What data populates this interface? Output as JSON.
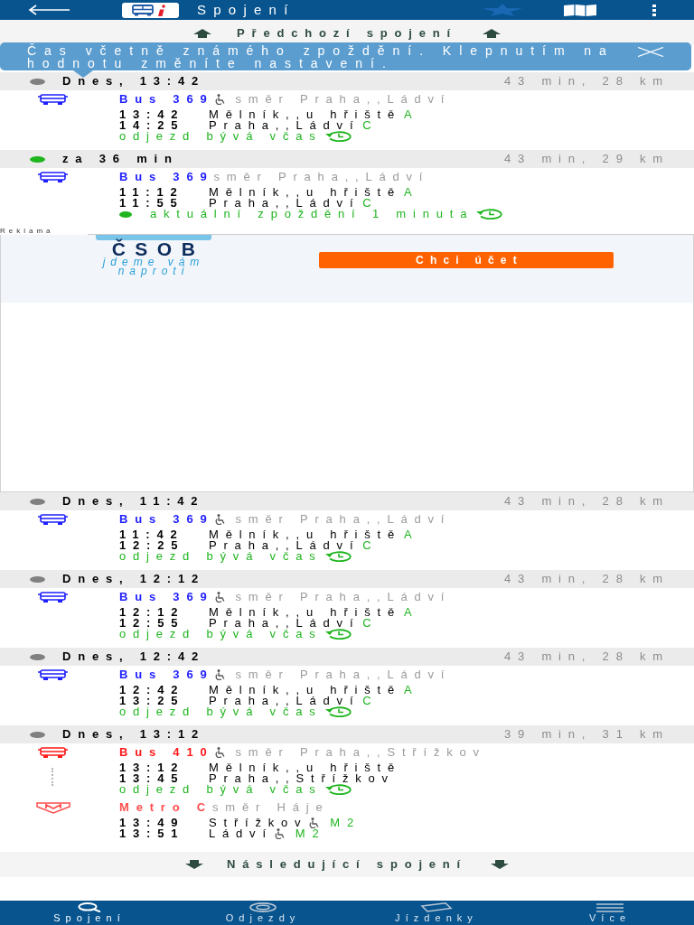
{
  "top_bar": {
    "title": "Spojení"
  },
  "previous": {
    "label": "Předchozí spojení"
  },
  "tooltip": {
    "text": "Čas včetně známého zpoždění. Klepnutím na hodnotu změníte nastavení."
  },
  "connections": [
    {
      "header": "Dnes, 13:42",
      "color": "#808080",
      "summary": "43 min, 28 km",
      "legs": [
        {
          "kind": "bus",
          "line": "Bus 369",
          "color": "#1f1fff",
          "accessible": true,
          "direction": "směr Praha,,Ládví",
          "stops": [
            {
              "time": "13:42",
              "name": "Mělník,,u hřiště",
              "accessible": false,
              "platform": "A"
            },
            {
              "time": "14:25",
              "name": "Praha,,Ládví",
              "accessible": false,
              "platform": "C"
            }
          ],
          "status": {
            "text": "odjezd bývá včas",
            "live": false
          }
        }
      ]
    },
    {
      "header": "za 36 min",
      "color": "#1fb51f",
      "summary": "43 min, 29 km",
      "legs": [
        {
          "kind": "bus",
          "line": "Bus 369",
          "color": "#1f1fff",
          "accessible": false,
          "direction": "směr Praha,,Ládví",
          "stops": [
            {
              "time": "11:12",
              "name": "Mělník,,u hřiště",
              "accessible": false,
              "platform": "A"
            },
            {
              "time": "11:55",
              "name": "Praha,,Ládví",
              "accessible": false,
              "platform": "C"
            }
          ],
          "status": {
            "text": "aktuální zpoždění 1 minuta",
            "live": true
          }
        }
      ]
    }
  ],
  "ad": {
    "label": "Reklama",
    "logo": "ČSOB",
    "slogan": "jdeme vám naproti",
    "button": "Chci účet"
  },
  "more_connections": [
    {
      "header": "Dnes, 11:42",
      "color": "#808080",
      "summary": "43 min, 28 km",
      "legs": [
        {
          "kind": "bus",
          "line": "Bus 369",
          "color": "#1f1fff",
          "accessible": true,
          "direction": "směr Praha,,Ládví",
          "stops": [
            {
              "time": "11:42",
              "name": "Mělník,,u hřiště",
              "accessible": false,
              "platform": "A"
            },
            {
              "time": "12:25",
              "name": "Praha,,Ládví",
              "accessible": false,
              "platform": "C"
            }
          ],
          "status": {
            "text": "odjezd bývá včas",
            "live": false
          }
        }
      ]
    },
    {
      "header": "Dnes, 12:12",
      "color": "#808080",
      "summary": "43 min, 28 km",
      "legs": [
        {
          "kind": "bus",
          "line": "Bus 369",
          "color": "#1f1fff",
          "accessible": true,
          "direction": "směr Praha,,Ládví",
          "stops": [
            {
              "time": "12:12",
              "name": "Mělník,,u hřiště",
              "accessible": false,
              "platform": "A"
            },
            {
              "time": "12:55",
              "name": "Praha,,Ládví",
              "accessible": false,
              "platform": "C"
            }
          ],
          "status": {
            "text": "odjezd bývá včas",
            "live": false
          }
        }
      ]
    },
    {
      "header": "Dnes, 12:42",
      "color": "#808080",
      "summary": "43 min, 28 km",
      "legs": [
        {
          "kind": "bus",
          "line": "Bus 369",
          "color": "#1f1fff",
          "accessible": true,
          "direction": "směr Praha,,Ládví",
          "stops": [
            {
              "time": "12:42",
              "name": "Mělník,,u hřiště",
              "accessible": false,
              "platform": "A"
            },
            {
              "time": "13:25",
              "name": "Praha,,Ládví",
              "accessible": false,
              "platform": "C"
            }
          ],
          "status": {
            "text": "odjezd bývá včas",
            "live": false
          }
        }
      ]
    },
    {
      "header": "Dnes, 13:12",
      "color": "#808080",
      "summary": "39 min, 31 km",
      "legs": [
        {
          "kind": "bus",
          "line": "Bus 410",
          "color": "#ff1a1a",
          "accessible": true,
          "direction": "směr Praha,,Střížkov",
          "stops": [
            {
              "time": "13:12",
              "name": "Mělník,,u hřiště",
              "accessible": false
            },
            {
              "time": "13:45",
              "name": "Praha,,Střížkov",
              "accessible": false
            }
          ],
          "status": {
            "text": "odjezd bývá včas",
            "live": false
          }
        },
        {
          "kind": "metro",
          "line": "Metro C",
          "color": "#ff4d4d",
          "accessible": false,
          "direction": "směr Háje",
          "stops": [
            {
              "time": "13:49",
              "name": "Střížkov",
              "accessible": true,
              "platform": "M2"
            },
            {
              "time": "13:51",
              "name": "Ládví",
              "accessible": true,
              "platform": "M2"
            }
          ]
        }
      ]
    }
  ],
  "next": {
    "label": "Následující spojení"
  },
  "bottom_nav": [
    {
      "kind": "search",
      "label": "Spojení",
      "selected": true
    },
    {
      "kind": "departures",
      "label": "Odjezdy",
      "selected": false
    },
    {
      "kind": "tickets",
      "label": "Jízdenky",
      "selected": false
    },
    {
      "kind": "more",
      "label": "Více",
      "selected": false
    }
  ]
}
